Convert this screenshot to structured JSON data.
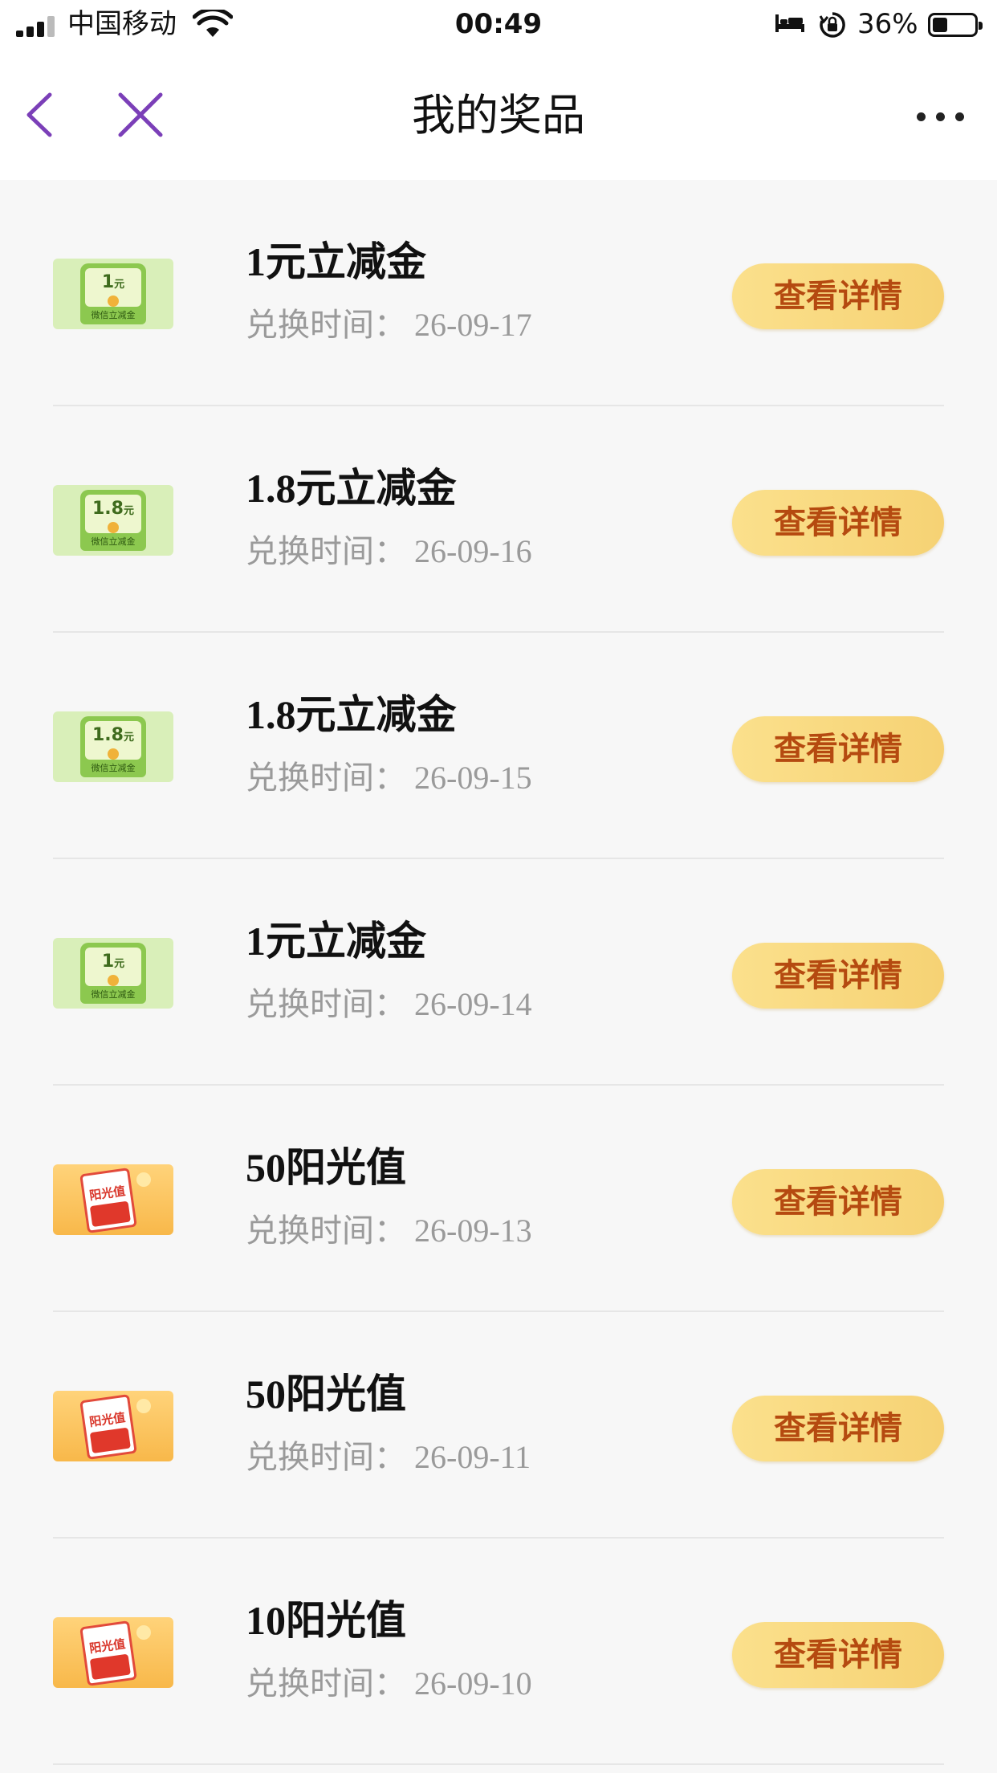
{
  "status_bar": {
    "carrier": "中国移动",
    "time": "00:49",
    "battery_percent": "36%",
    "battery_level": 0.36,
    "icons": [
      "signal-icon",
      "wifi-icon",
      "bed-icon",
      "rotation-lock-icon",
      "battery-icon"
    ]
  },
  "nav": {
    "title": "我的奖品",
    "back_icon": "chevron-left-icon",
    "close_icon": "close-icon",
    "more_icon": "more-dots-icon",
    "accent_color": "#7b3fb8"
  },
  "prizes": [
    {
      "name": "1元立减金",
      "time": "兑换时间：  26-09-17",
      "button": "查看详情",
      "thumb_type": "green-envelope",
      "thumb_amount": "1",
      "thumb_unit": "元",
      "thumb_caption": "微信立减金"
    },
    {
      "name": "1.8元立减金",
      "time": "兑换时间：  26-09-16",
      "button": "查看详情",
      "thumb_type": "green-envelope",
      "thumb_amount": "1.8",
      "thumb_unit": "元",
      "thumb_caption": "微信立减金"
    },
    {
      "name": "1.8元立减金",
      "time": "兑换时间：  26-09-15",
      "button": "查看详情",
      "thumb_type": "green-envelope",
      "thumb_amount": "1.8",
      "thumb_unit": "元",
      "thumb_caption": "微信立减金"
    },
    {
      "name": "1元立减金",
      "time": "兑换时间：  26-09-14",
      "button": "查看详情",
      "thumb_type": "green-envelope",
      "thumb_amount": "1",
      "thumb_unit": "元",
      "thumb_caption": "微信立减金"
    },
    {
      "name": "50阳光值",
      "time": "兑换时间：  26-09-13",
      "button": "查看详情",
      "thumb_type": "sunshine-card",
      "thumb_label": "阳光值"
    },
    {
      "name": "50阳光值",
      "time": "兑换时间：  26-09-11",
      "button": "查看详情",
      "thumb_type": "sunshine-card",
      "thumb_label": "阳光值"
    },
    {
      "name": "10阳光值",
      "time": "兑换时间：  26-09-10",
      "button": "查看详情",
      "thumb_type": "sunshine-card",
      "thumb_label": "阳光值"
    }
  ],
  "colors": {
    "button_gradient_start": "#fbe08c",
    "button_gradient_end": "#f6d274",
    "button_text": "#b54a10",
    "time_text": "#9a9a9a",
    "page_bg": "#f7f7f7"
  }
}
